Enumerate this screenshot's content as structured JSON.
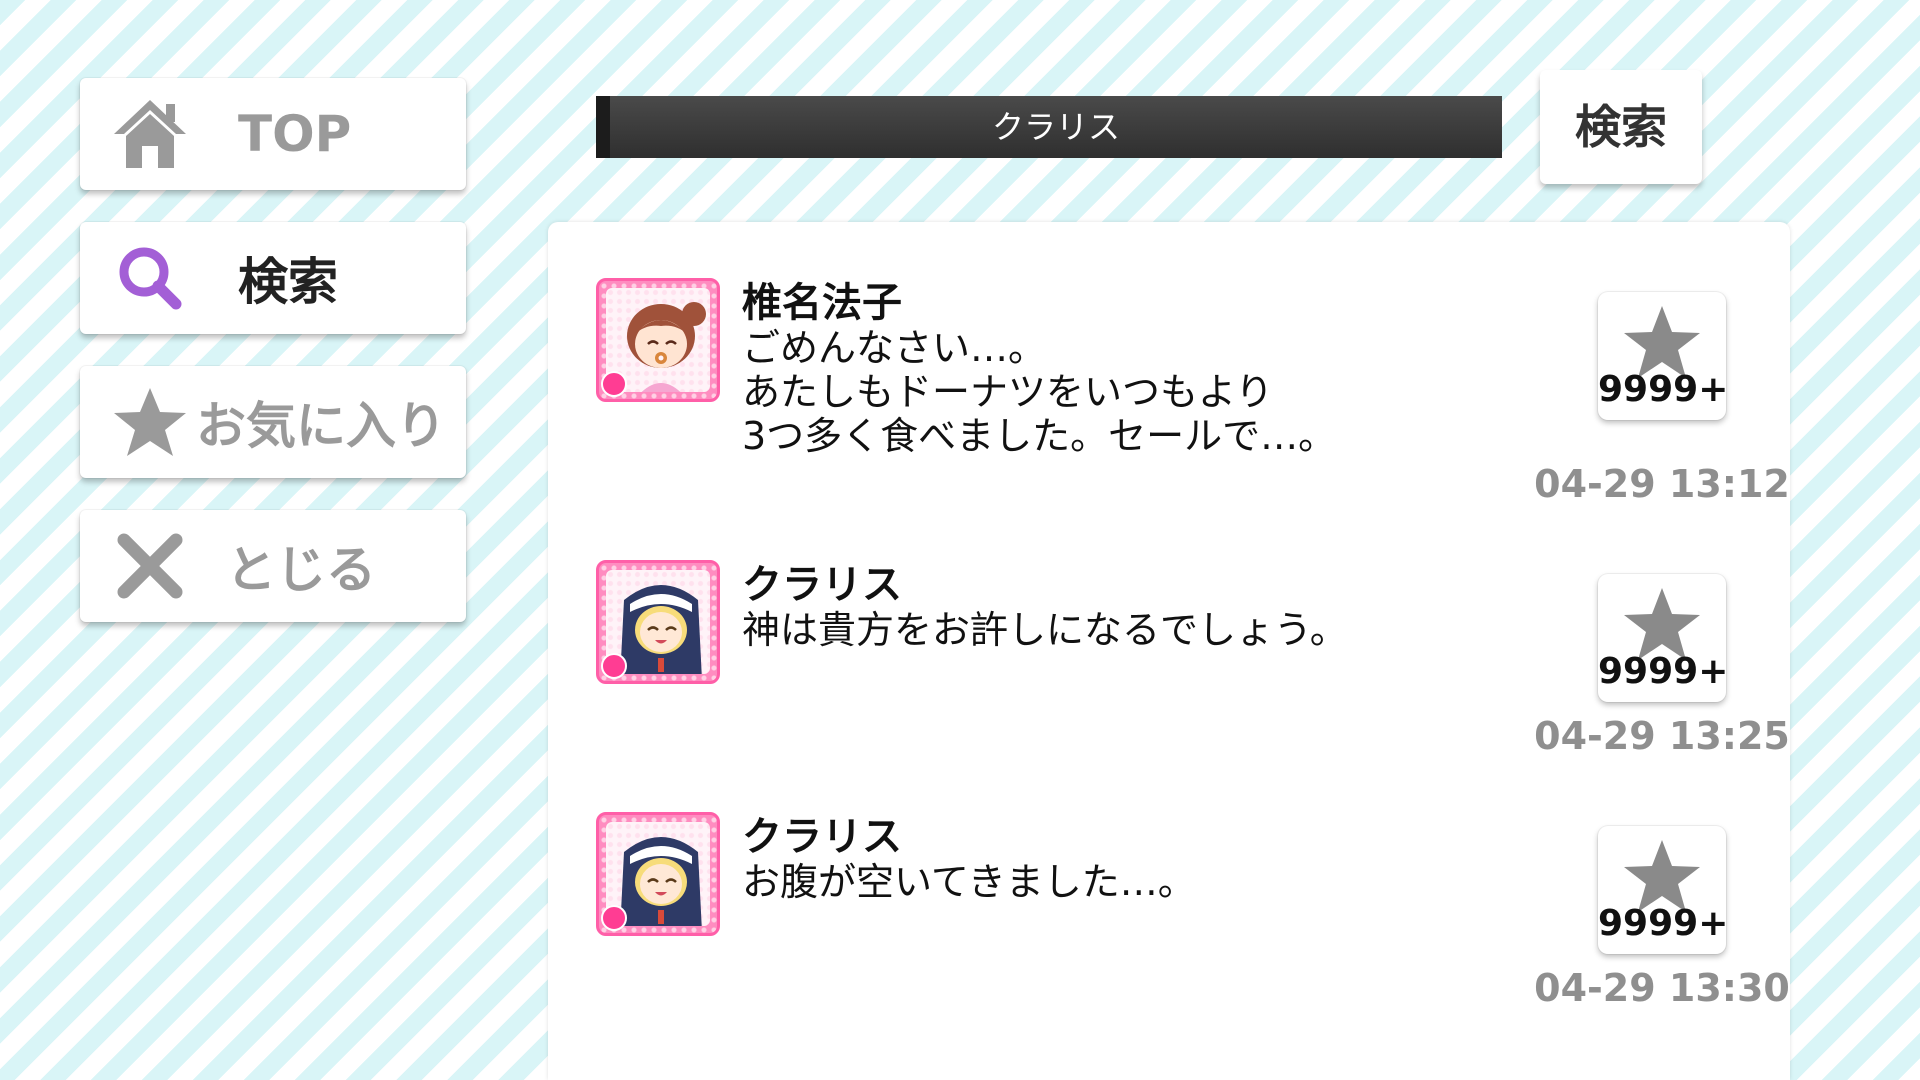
{
  "sidebar": {
    "top": {
      "label": "TOP",
      "icon": "home-icon"
    },
    "search": {
      "label": "検索",
      "icon": "search-icon",
      "active": true
    },
    "favorites": {
      "label": "お気に入り",
      "icon": "star-icon"
    },
    "close": {
      "label": "とじる",
      "icon": "close-icon"
    }
  },
  "search": {
    "query": "クラリス",
    "button_label": "検索"
  },
  "messages": [
    {
      "sender": "椎名法子",
      "text": "ごめんなさい…。\nあたしもドーナツをいつもより\n3つ多く食べました。セールで…。",
      "likes": "9999+",
      "time": "04-29 13:12"
    },
    {
      "sender": "クラリス",
      "text": "神は貴方をお許しになるでしょう。",
      "likes": "9999+",
      "time": "04-29 13:25"
    },
    {
      "sender": "クラリス",
      "text": "お腹が空いてきました…。",
      "likes": "9999+",
      "time": "04-29 13:30"
    }
  ],
  "colors": {
    "accent_purple": "#a35fd6",
    "icon_gray": "#9a9a9a",
    "avatar_pink": "#ff5fa8",
    "stripe": "#d9f5f7"
  }
}
